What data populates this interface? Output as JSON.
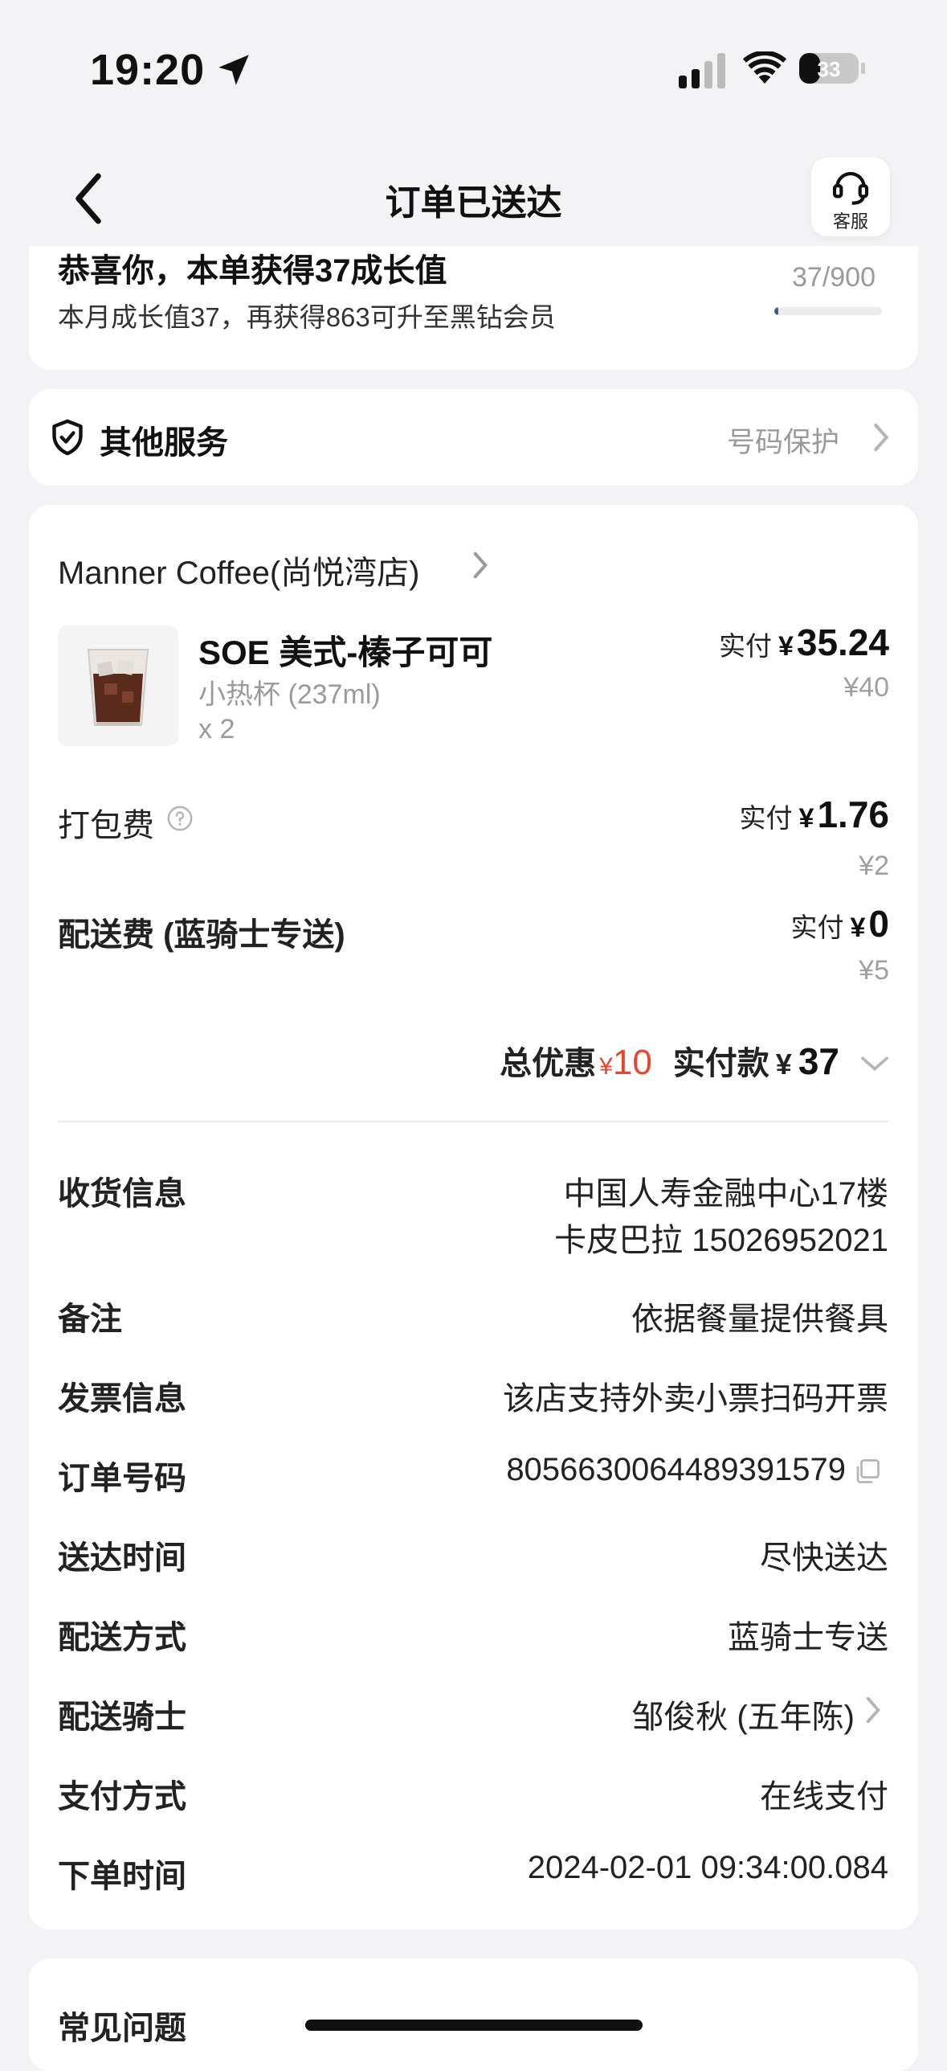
{
  "status_bar": {
    "time": "19:20",
    "battery": "33"
  },
  "header": {
    "title": "订单已送达",
    "service_label": "客服"
  },
  "growth": {
    "title": "恭喜你，本单获得37成长值",
    "subtitle": "本月成长值37，再获得863可升至黑钻会员",
    "count": "37/900",
    "progress_fraction": 0.041
  },
  "other_services": {
    "title": "其他服务",
    "value": "号码保护"
  },
  "store": {
    "name": "Manner Coffee(尚悦湾店)"
  },
  "product": {
    "name": "SOE 美式-榛子可可",
    "spec": "小热杯 (237ml)",
    "qty": "x 2",
    "pay_label": "实付",
    "yen": "¥",
    "paid": "35.24",
    "original": "¥40"
  },
  "packing_fee": {
    "label": "打包费",
    "pay_label": "实付",
    "yen": "¥",
    "paid": "1.76",
    "original": "¥2"
  },
  "delivery_fee": {
    "label": "配送费 (蓝骑士专送)",
    "pay_label": "实付",
    "yen": "¥",
    "paid": "0",
    "original": "¥5"
  },
  "totals": {
    "discount_label": "总优惠",
    "discount_yen": "¥",
    "discount_amount": "10",
    "paid_label": "实付款",
    "paid_yen": "¥",
    "paid_amount": "37"
  },
  "info": {
    "address_label": "收货信息",
    "address_line1": "中国人寿金融中心17楼",
    "address_line2": "卡皮巴拉 15026952021",
    "note_label": "备注",
    "note_value": "依据餐量提供餐具",
    "invoice_label": "发票信息",
    "invoice_value": "该店支持外卖小票扫码开票",
    "order_no_label": "订单号码",
    "order_no_value": "8056630064489391579",
    "arrival_label": "送达时间",
    "arrival_value": "尽快送达",
    "method_label": "配送方式",
    "method_value": "蓝骑士专送",
    "rider_label": "配送骑士",
    "rider_value": "邹俊秋 (五年陈)",
    "payment_label": "支付方式",
    "payment_value": "在线支付",
    "ordered_label": "下单时间",
    "ordered_value": "2024-02-01 09:34:00.084"
  },
  "faq": {
    "title": "常见问题"
  },
  "colors": {
    "accent_red": "#e8452c",
    "bg": "#f3f3f5",
    "muted": "#9a9a9a"
  }
}
